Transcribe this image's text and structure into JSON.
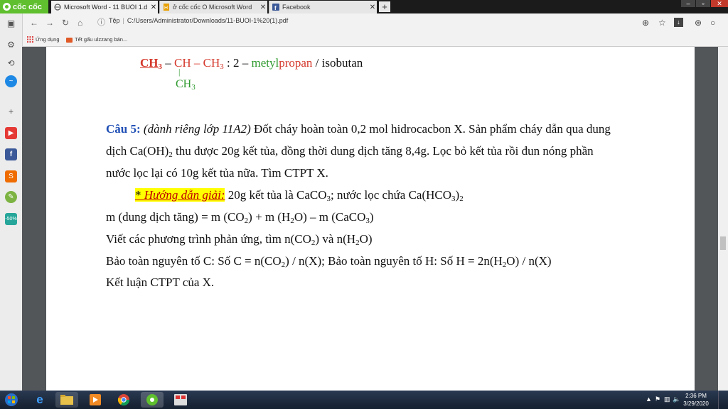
{
  "browser": {
    "brand": "cốc cốc",
    "tabs": [
      {
        "label": "Microsoft Word - 11 BUOI 1.d",
        "close": "✕"
      },
      {
        "label": "ở cốc cốc O Microsoft Word",
        "close": "✕"
      },
      {
        "label": "Facebook",
        "close": "✕"
      }
    ],
    "new_tab": "+",
    "address_prefix": "Tệp",
    "address_path": "C:/Users/Administrator/Downloads/11-BUOI-1%20(1).pdf",
    "bookmarks": [
      "Ứng dụng",
      "Tết gấu ulzzang bán..."
    ]
  },
  "sidebar": {
    "promo_label": "-50%"
  },
  "doc": {
    "l1": {
      "ch3a": "CH",
      "sub3a": "3",
      "dash1": " – ",
      "ch": "CH",
      "dash2": " – ",
      "ch3b": "CH",
      "sub3b": "3",
      "colon": " : 2 – ",
      "metyl": "metyl",
      "propan": "propan",
      "iso": " / isobutan"
    },
    "branch": {
      "bar": "|",
      "ch3": "CH",
      "sub": "3"
    },
    "q5": {
      "label": "Câu 5:",
      "note": " (dành riêng lớp 11A2)",
      "text1": " Đốt cháy hoàn toàn 0,2 mol hidrocacbon X. Sản phẩm cháy dẫn qua dung",
      "line2a": "dịch Ca(OH)",
      "line2sub": "2",
      "line2b": " thu được 20g kết tủa, đồng thời dung dịch tăng 8,4g. Lọc bỏ kết tủa rồi đun nóng phần",
      "line3": "nước lọc lại có 10g kết tủa nữa. Tìm CTPT X."
    },
    "hint": {
      "star": "* ",
      "label": "Hướng dẫn giải:",
      "t1": " 20g kết tủa là CaCO",
      "s1": "3",
      "t2": "; nước lọc chứa Ca(HCO",
      "s2": "3",
      "t3": ")",
      "s3": "2"
    },
    "l5": {
      "a": "m (dung dịch tăng) = m (CO",
      "s1": "2",
      "b": ") + m (H",
      "s2": "2",
      "c": "O) – m (CaCO",
      "s3": "3",
      "d": ")"
    },
    "l6": {
      "a": "Viết các phương trình phản ứng, tìm n(CO",
      "s1": "2",
      "b": ") và  n(H",
      "s2": "2",
      "c": "O)"
    },
    "l7": {
      "a": "Bảo toàn nguyên tố C: Số C = n(CO",
      "s1": "2",
      "b": ") / n(X); Bảo toàn nguyên tố H: Số H = 2n(H",
      "s2": "2",
      "c": "O) / n(X)"
    },
    "l8": "Kết luận CTPT của X."
  },
  "taskbar": {
    "time": "2:36 PM",
    "date": "3/29/2020"
  }
}
